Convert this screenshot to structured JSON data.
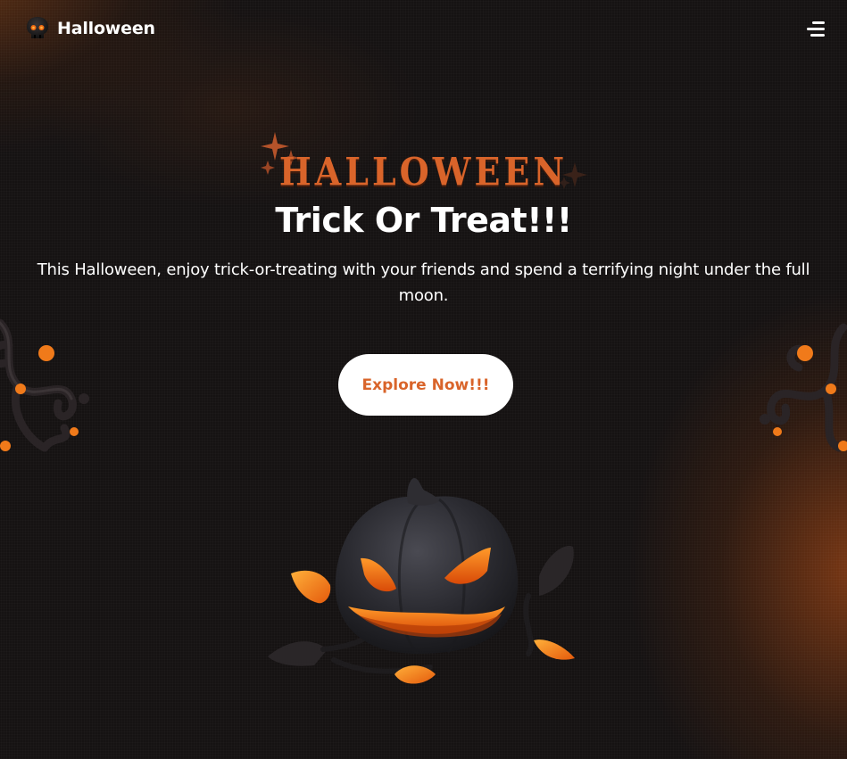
{
  "header": {
    "logo_text": "Halloween",
    "logo_icon": "skull-icon",
    "menu_icon": "hamburger-menu-icon"
  },
  "hero": {
    "brand_title": "HALLOWEEN",
    "headline": "Trick Or Treat!!!",
    "subtext": "This Halloween, enjoy trick-or-treating with your friends and spend a terrifying night under the full moon.",
    "cta_label": "Explore Now!!!"
  },
  "colors": {
    "accent": "#d9642a",
    "background": "#151212",
    "text": "#ffffff",
    "button_bg": "#ffffff",
    "glow": "#f7841a"
  },
  "decorations": {
    "left": "sparkle-stars-icon",
    "right": "sparkle-stars-icon",
    "branches": "spooky-branch-icon",
    "centerpiece": "jack-o-lantern-icon"
  }
}
